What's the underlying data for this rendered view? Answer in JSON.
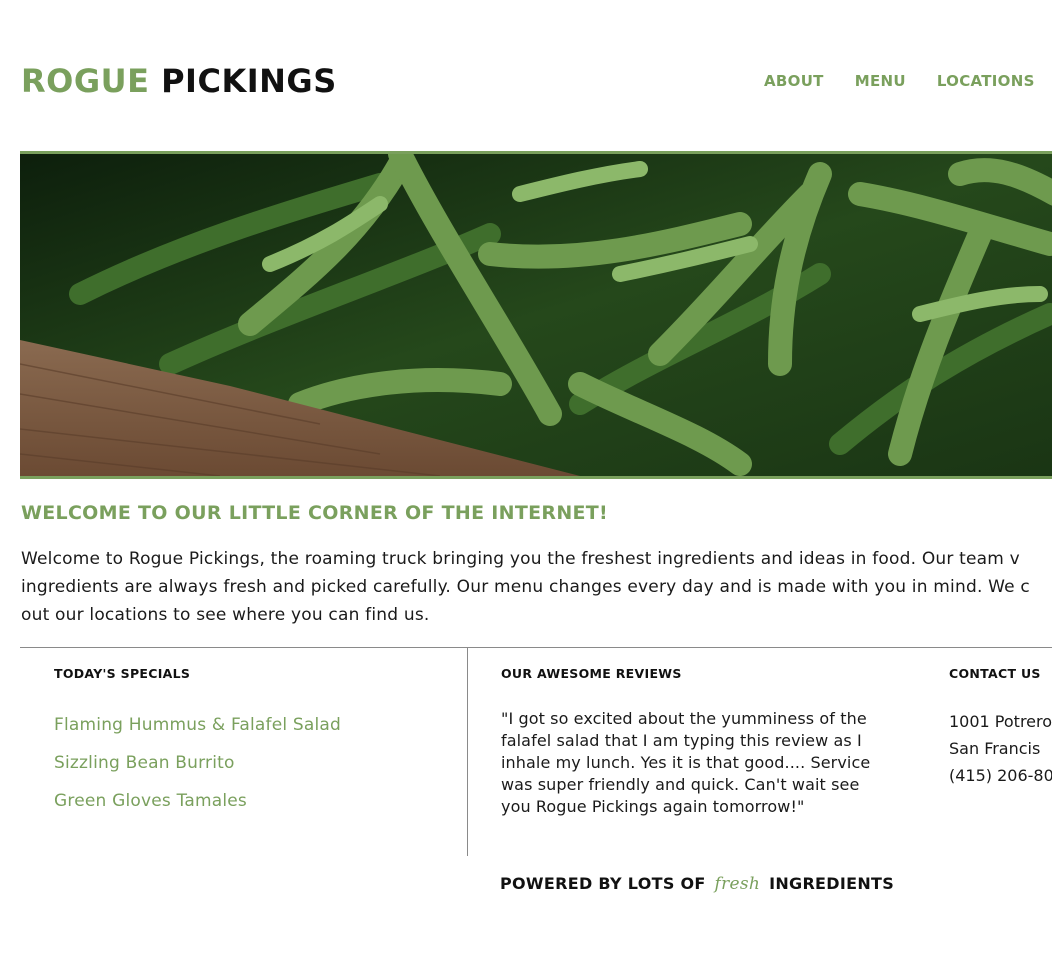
{
  "header": {
    "logo_part1": "ROGUE",
    "logo_part2": "PICKINGS",
    "nav": [
      "ABOUT",
      "MENU",
      "LOCATIONS"
    ]
  },
  "hero": {
    "icon": "green-beans-photo"
  },
  "welcome": {
    "title": "WELCOME TO OUR LITTLE CORNER OF THE INTERNET!",
    "text": "Welcome to Rogue Pickings, the roaming truck bringing you the freshest ingredients and ideas in food. Our team v ingredients are always fresh and picked carefully. Our menu changes every day and is made with you in mind. We c out our locations to see where you can find us."
  },
  "specials": {
    "heading": "TODAY'S SPECIALS",
    "items": [
      "Flaming Hummus & Falafel Salad",
      "Sizzling Bean Burrito",
      "Green Gloves Tamales"
    ]
  },
  "reviews": {
    "heading": "OUR AWESOME REVIEWS",
    "quote": "\"I got so excited about the yumminess of the falafel salad that I am typing this review as I inhale my lunch. Yes it is that good.... Service was super friendly and quick. Can't wait see you Rogue Pickings again tomorrow!\""
  },
  "contact": {
    "heading": "CONTACT US",
    "lines": [
      "1001 Potrero",
      "San Francis",
      "(415) 206-80"
    ]
  },
  "footer": {
    "before": "POWERED BY LOTS OF",
    "accent": "fresh",
    "after": "INGREDIENTS"
  },
  "colors": {
    "accent": "#7aa05d",
    "text": "#1a1a1a",
    "divider": "#8a8a8a"
  }
}
